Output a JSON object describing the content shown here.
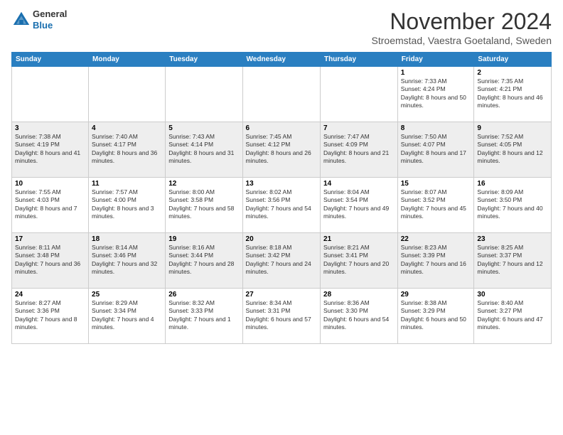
{
  "header": {
    "logo_general": "General",
    "logo_blue": "Blue",
    "month_title": "November 2024",
    "location": "Stroemstad, Vaestra Goetaland, Sweden"
  },
  "days_of_week": [
    "Sunday",
    "Monday",
    "Tuesday",
    "Wednesday",
    "Thursday",
    "Friday",
    "Saturday"
  ],
  "weeks": [
    {
      "days": [
        {
          "num": "",
          "info": ""
        },
        {
          "num": "",
          "info": ""
        },
        {
          "num": "",
          "info": ""
        },
        {
          "num": "",
          "info": ""
        },
        {
          "num": "",
          "info": ""
        },
        {
          "num": "1",
          "info": "Sunrise: 7:33 AM\nSunset: 4:24 PM\nDaylight: 8 hours and 50 minutes."
        },
        {
          "num": "2",
          "info": "Sunrise: 7:35 AM\nSunset: 4:21 PM\nDaylight: 8 hours and 46 minutes."
        }
      ]
    },
    {
      "days": [
        {
          "num": "3",
          "info": "Sunrise: 7:38 AM\nSunset: 4:19 PM\nDaylight: 8 hours and 41 minutes."
        },
        {
          "num": "4",
          "info": "Sunrise: 7:40 AM\nSunset: 4:17 PM\nDaylight: 8 hours and 36 minutes."
        },
        {
          "num": "5",
          "info": "Sunrise: 7:43 AM\nSunset: 4:14 PM\nDaylight: 8 hours and 31 minutes."
        },
        {
          "num": "6",
          "info": "Sunrise: 7:45 AM\nSunset: 4:12 PM\nDaylight: 8 hours and 26 minutes."
        },
        {
          "num": "7",
          "info": "Sunrise: 7:47 AM\nSunset: 4:09 PM\nDaylight: 8 hours and 21 minutes."
        },
        {
          "num": "8",
          "info": "Sunrise: 7:50 AM\nSunset: 4:07 PM\nDaylight: 8 hours and 17 minutes."
        },
        {
          "num": "9",
          "info": "Sunrise: 7:52 AM\nSunset: 4:05 PM\nDaylight: 8 hours and 12 minutes."
        }
      ]
    },
    {
      "days": [
        {
          "num": "10",
          "info": "Sunrise: 7:55 AM\nSunset: 4:03 PM\nDaylight: 8 hours and 7 minutes."
        },
        {
          "num": "11",
          "info": "Sunrise: 7:57 AM\nSunset: 4:00 PM\nDaylight: 8 hours and 3 minutes."
        },
        {
          "num": "12",
          "info": "Sunrise: 8:00 AM\nSunset: 3:58 PM\nDaylight: 7 hours and 58 minutes."
        },
        {
          "num": "13",
          "info": "Sunrise: 8:02 AM\nSunset: 3:56 PM\nDaylight: 7 hours and 54 minutes."
        },
        {
          "num": "14",
          "info": "Sunrise: 8:04 AM\nSunset: 3:54 PM\nDaylight: 7 hours and 49 minutes."
        },
        {
          "num": "15",
          "info": "Sunrise: 8:07 AM\nSunset: 3:52 PM\nDaylight: 7 hours and 45 minutes."
        },
        {
          "num": "16",
          "info": "Sunrise: 8:09 AM\nSunset: 3:50 PM\nDaylight: 7 hours and 40 minutes."
        }
      ]
    },
    {
      "days": [
        {
          "num": "17",
          "info": "Sunrise: 8:11 AM\nSunset: 3:48 PM\nDaylight: 7 hours and 36 minutes."
        },
        {
          "num": "18",
          "info": "Sunrise: 8:14 AM\nSunset: 3:46 PM\nDaylight: 7 hours and 32 minutes."
        },
        {
          "num": "19",
          "info": "Sunrise: 8:16 AM\nSunset: 3:44 PM\nDaylight: 7 hours and 28 minutes."
        },
        {
          "num": "20",
          "info": "Sunrise: 8:18 AM\nSunset: 3:42 PM\nDaylight: 7 hours and 24 minutes."
        },
        {
          "num": "21",
          "info": "Sunrise: 8:21 AM\nSunset: 3:41 PM\nDaylight: 7 hours and 20 minutes."
        },
        {
          "num": "22",
          "info": "Sunrise: 8:23 AM\nSunset: 3:39 PM\nDaylight: 7 hours and 16 minutes."
        },
        {
          "num": "23",
          "info": "Sunrise: 8:25 AM\nSunset: 3:37 PM\nDaylight: 7 hours and 12 minutes."
        }
      ]
    },
    {
      "days": [
        {
          "num": "24",
          "info": "Sunrise: 8:27 AM\nSunset: 3:36 PM\nDaylight: 7 hours and 8 minutes."
        },
        {
          "num": "25",
          "info": "Sunrise: 8:29 AM\nSunset: 3:34 PM\nDaylight: 7 hours and 4 minutes."
        },
        {
          "num": "26",
          "info": "Sunrise: 8:32 AM\nSunset: 3:33 PM\nDaylight: 7 hours and 1 minute."
        },
        {
          "num": "27",
          "info": "Sunrise: 8:34 AM\nSunset: 3:31 PM\nDaylight: 6 hours and 57 minutes."
        },
        {
          "num": "28",
          "info": "Sunrise: 8:36 AM\nSunset: 3:30 PM\nDaylight: 6 hours and 54 minutes."
        },
        {
          "num": "29",
          "info": "Sunrise: 8:38 AM\nSunset: 3:29 PM\nDaylight: 6 hours and 50 minutes."
        },
        {
          "num": "30",
          "info": "Sunrise: 8:40 AM\nSunset: 3:27 PM\nDaylight: 6 hours and 47 minutes."
        }
      ]
    }
  ]
}
